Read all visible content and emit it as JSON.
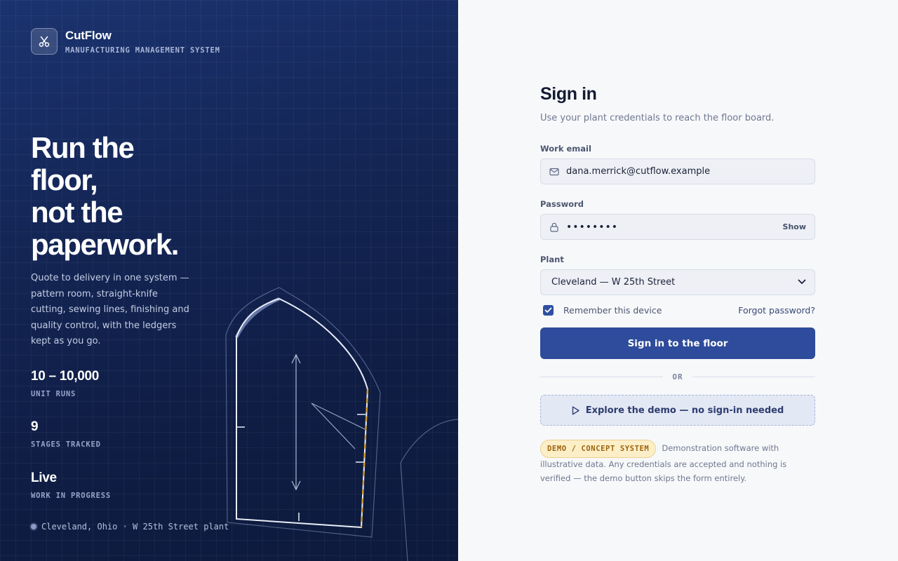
{
  "brand": {
    "name": "CutFlow",
    "tagline": "MANUFACTURING MANAGEMENT SYSTEM",
    "logo_icon": "scissors-icon"
  },
  "hero": {
    "headline_lines": [
      "Run the",
      "floor,",
      "not the",
      "paperwork."
    ],
    "lede": "Quote to delivery in one system — pattern room, straight-knife cutting, sewing lines, finishing and quality control, with the ledgers kept as you go."
  },
  "stats": [
    {
      "value": "10 – 10,000",
      "label": "UNIT RUNS"
    },
    {
      "value": "9",
      "label": "STAGES TRACKED"
    },
    {
      "value": "Live",
      "label": "WORK IN PROGRESS"
    }
  ],
  "location": "Cleveland, Ohio · W 25th Street plant",
  "form": {
    "title": "Sign in",
    "subtitle": "Use your plant credentials to reach the floor board.",
    "email_label": "Work email",
    "email_value": "dana.merrick@cutflow.example",
    "password_label": "Password",
    "password_value": "password",
    "show_label": "Show",
    "plant_label": "Plant",
    "plant_selected": "Cleveland — W 25th Street",
    "remember_label": "Remember this device",
    "remember_checked": true,
    "forgot_label": "Forgot password?",
    "submit_label": "Sign in to the floor",
    "or_label": "OR",
    "demo_label": "Explore the demo — no sign-in needed"
  },
  "notice": {
    "badge": "DEMO / CONCEPT SYSTEM",
    "text": "Demonstration software with illustrative data. Any credentials are accepted and nothing is verified — the demo button skips the form entirely."
  },
  "colors": {
    "panel_dark": "#142656",
    "primary": "#2e4c9b",
    "accent_dash": "#d49a2a",
    "badge_bg": "#fcefc8"
  }
}
